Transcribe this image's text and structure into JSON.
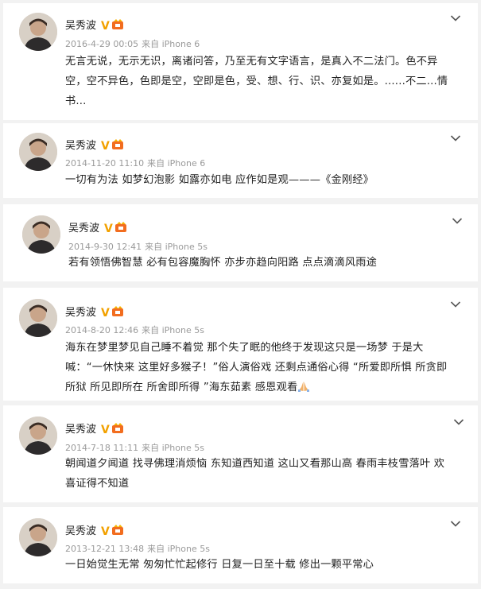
{
  "posts": [
    {
      "author": "吴秀波",
      "date": "2016-4-29 00:05",
      "via": "来自 iPhone 6",
      "lines": [
        "无言无说，无示无识，离诸问答，乃至无有文字语言，是真入不二法门。色不异",
        "空，空不异色，色即是空，空即是色，受、想、行、识、亦复如是。......不二...情",
        "书..."
      ]
    },
    {
      "author": "吴秀波",
      "date": "2014-11-20 11:10",
      "via": "来自 iPhone 6",
      "lines": [
        "一切有为法 如梦幻泡影 如露亦如电 应作如是观———《金刚经》"
      ]
    },
    {
      "author": "吴秀波",
      "date": "2014-9-30 12:41",
      "via": "来自 iPhone 5s",
      "lines": [
        "若有领悟佛智慧 必有包容魔胸怀 亦步亦趋向阳路 点点滴滴风雨途"
      ]
    },
    {
      "author": "吴秀波",
      "date": "2014-8-20 12:46",
      "via": "来自 iPhone 5s",
      "lines": [
        "海东在梦里梦见自己睡不着觉 那个失了眠的他终于发现这只是一场梦 于是大",
        "喊：“一休快来 这里好多猴子！”俗人演俗戏 还剩点通俗心得 “所爱即所惧 所贪即",
        "所狱 所见即所在 所舍即所得 ”海东茹素 感恩观看"
      ]
    },
    {
      "author": "吴秀波",
      "date": "2014-7-18 11:11",
      "via": "来自 iPhone 5s",
      "lines": [
        "朝闻道夕闻道 找寻佛理消烦恼 东知道西知道 这山又看那山高 春雨丰枝雪落叶 欢",
        "喜证得不知道"
      ]
    },
    {
      "author": "吴秀波",
      "date": "2013-12-21 13:48",
      "via": "来自 iPhone 5s",
      "lines": [
        "一日始觉生无常 匆匆忙忙起修行 日复一日至十载 修出一颗平常心"
      ]
    }
  ],
  "icons": {
    "avatar": "avatar-photo",
    "verified": "V",
    "member": "member-crown-icon",
    "menu": "chevron-down-icon",
    "emoji": "praying-hands-icon"
  },
  "colors": {
    "verified": "#f2a100",
    "member": "#f26d1f",
    "meta": "#9a9a9a",
    "text": "#222222"
  }
}
